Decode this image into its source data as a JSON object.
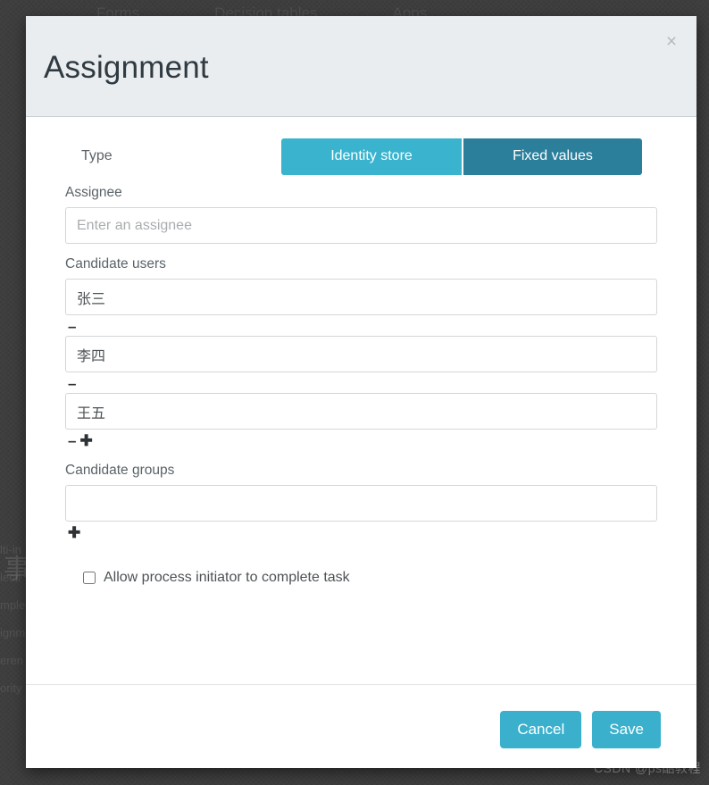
{
  "background": {
    "nav_items": [
      "Forms",
      "Decision tables",
      "Apps"
    ],
    "panel_items": [
      "lti-in",
      "lecti",
      "mple",
      "ignm",
      "eren",
      "ority"
    ],
    "cjk_fragment": "事"
  },
  "modal": {
    "title": "Assignment",
    "close_icon_label": "×",
    "type": {
      "label": "Type",
      "options": [
        "Identity store",
        "Fixed values"
      ],
      "selected": "Fixed values"
    },
    "assignee": {
      "label": "Assignee",
      "placeholder": "Enter an assignee",
      "value": ""
    },
    "candidate_users": {
      "label": "Candidate users",
      "rows": [
        {
          "value": "张三",
          "remove_icon": "–",
          "add_icon": ""
        },
        {
          "value": "李四",
          "remove_icon": "–",
          "add_icon": ""
        },
        {
          "value": "王五",
          "remove_icon": "–",
          "add_icon": "✚"
        }
      ]
    },
    "candidate_groups": {
      "label": "Candidate groups",
      "rows": [
        {
          "value": "",
          "placeholder": "",
          "add_icon": "✚"
        }
      ]
    },
    "initiator_checkbox": {
      "label": "Allow process initiator to complete task",
      "checked": false
    },
    "footer": {
      "cancel_label": "Cancel",
      "save_label": "Save"
    }
  },
  "watermark": "CSDN @ps酷教程",
  "colors": {
    "accent_light": "#3ab3ce",
    "accent_dark": "#2b7f9b",
    "header_bg": "#e9edf0",
    "button_teal": "#3ab0cc"
  }
}
